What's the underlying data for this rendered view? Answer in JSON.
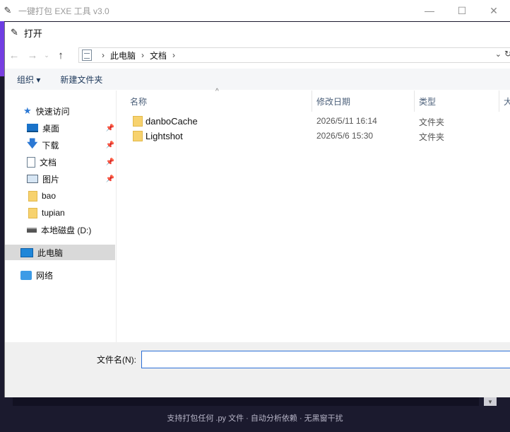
{
  "app": {
    "title": "一键打包 EXE 工具 v3.0",
    "footer_text": "支持打包任何 .py 文件 · 自动分析依赖 · 无黑窗干扰",
    "accent_color": "#6b3de3",
    "background_color": "#1b1a2e"
  },
  "dialog": {
    "title": "打开",
    "address": {
      "icon": "documents-folder-icon",
      "path": [
        "此电脑",
        "文档"
      ]
    },
    "toolbar": {
      "organize_label": "组织 ▾",
      "new_folder_label": "新建文件夹"
    },
    "sidebar": {
      "quick_access": "快速访问",
      "items": [
        {
          "label": "桌面",
          "icon": "desktop-icon",
          "pinned": true
        },
        {
          "label": "下载",
          "icon": "download-icon",
          "pinned": true
        },
        {
          "label": "文档",
          "icon": "documents-icon",
          "pinned": true
        },
        {
          "label": "图片",
          "icon": "pictures-icon",
          "pinned": true
        },
        {
          "label": "bao",
          "icon": "folder-icon",
          "pinned": false
        },
        {
          "label": "tupian",
          "icon": "folder-icon",
          "pinned": false
        },
        {
          "label": "本地磁盘 (D:)",
          "icon": "drive-icon",
          "pinned": false
        }
      ],
      "this_pc": "此电脑",
      "network": "网络"
    },
    "columns": {
      "name": "名称",
      "date": "修改日期",
      "type": "类型",
      "size": "大"
    },
    "files": [
      {
        "name": "danboCache",
        "date": "2026/5/11 16:14",
        "type": "文件夹"
      },
      {
        "name": "Lightshot",
        "date": "2026/5/6 15:30",
        "type": "文件夹"
      }
    ],
    "filename_label": "文件名(N):",
    "filename_value": ""
  }
}
